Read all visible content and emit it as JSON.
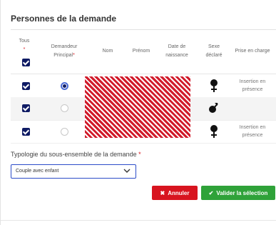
{
  "dialog": {
    "title": "Personnes de la demande"
  },
  "table": {
    "headers": {
      "tous": "Tous",
      "tous_req": "*",
      "demandeur": "Demandeur Principal",
      "demandeur_req": "*",
      "nom": "Nom",
      "prenom": "Prénom",
      "date": "Date de naissance",
      "sexe": "Sexe déclaré",
      "prise": "Prise en charge"
    },
    "rows": [
      {
        "selected": true,
        "principal": true,
        "sex_icon": "female-icon",
        "prise": "Insertion en présence"
      },
      {
        "selected": true,
        "principal": false,
        "sex_icon": "male-icon",
        "prise": ""
      },
      {
        "selected": true,
        "principal": false,
        "sex_icon": "female-icon",
        "prise": "Insertion en présence"
      }
    ]
  },
  "typologie": {
    "label": "Typologie du sous-ensemble de la demande",
    "req": "*",
    "selected": "Couple avec enfant"
  },
  "buttons": {
    "cancel_icon": "✖",
    "cancel": "Annuler",
    "ok_icon": "✔",
    "ok": "Valider la sélection"
  },
  "colors": {
    "checkbox": "#0f1b64",
    "cancel": "#d8141f",
    "ok": "#2fa239",
    "required": "#d9181f"
  }
}
